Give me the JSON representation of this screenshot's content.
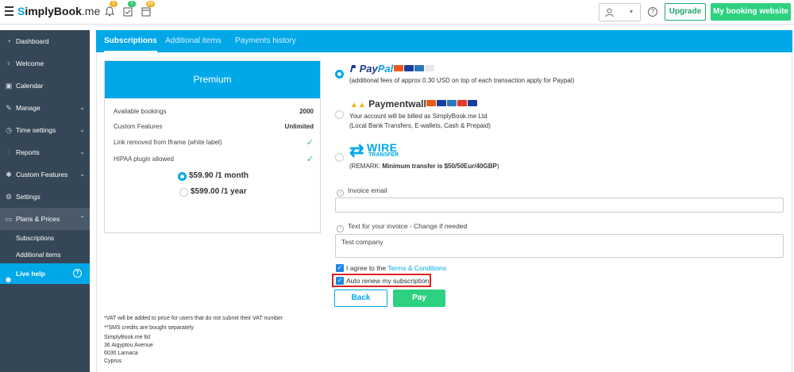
{
  "brand": {
    "logo_prefix": "S",
    "logo_main": "implyBook",
    "logo_suffix": ".me"
  },
  "topbar": {
    "notifications": [
      {
        "icon": "bell-icon",
        "badge": "0",
        "badge_color": "#f3b223"
      },
      {
        "icon": "tasks-icon",
        "badge": "0",
        "badge_color": "#2dc46c"
      },
      {
        "icon": "calendar-alert-icon",
        "badge": "99",
        "badge_color": "#f3b223"
      }
    ],
    "user_caret": "▾",
    "help": "?",
    "upgrade_label": "Upgrade",
    "booking_site_label": "My booking website"
  },
  "sidebar": {
    "items": [
      {
        "label": "Dashboard",
        "icon": "dashboard-icon",
        "has_chevron": false
      },
      {
        "label": "Welcome",
        "icon": "bulb-icon",
        "has_chevron": false
      },
      {
        "label": "Calendar",
        "icon": "calendar-icon",
        "has_chevron": false
      },
      {
        "label": "Manage",
        "icon": "pencil-icon",
        "has_chevron": true
      },
      {
        "label": "Time settings",
        "icon": "clock-icon",
        "has_chevron": true
      },
      {
        "label": "Reports",
        "icon": "chart-icon",
        "has_chevron": true
      },
      {
        "label": "Custom Features",
        "icon": "puzzle-icon",
        "has_chevron": true
      },
      {
        "label": "Settings",
        "icon": "gear-icon",
        "has_chevron": false
      },
      {
        "label": "Plans & Prices",
        "icon": "card-icon",
        "has_chevron": true
      }
    ],
    "subitems": [
      "Subscriptions",
      "Additional items"
    ],
    "live_help": "Live help"
  },
  "tabs": [
    {
      "label": "Subscriptions",
      "active": true
    },
    {
      "label": "Additional items",
      "active": false
    },
    {
      "label": "Payments history",
      "active": false
    }
  ],
  "plan": {
    "name": "Premium",
    "rows": [
      {
        "label": "Available bookings",
        "value": "2000"
      },
      {
        "label": "Custom Features",
        "value": "Unlimited"
      },
      {
        "label": "Link removed from Iframe (white label)",
        "value": "✓"
      },
      {
        "label": "HIPAA plugin allowed",
        "value": "✓"
      }
    ],
    "prices": [
      {
        "label": "$59.90 /1 month",
        "selected": true
      },
      {
        "label": "$599.00 /1 year",
        "selected": false
      }
    ]
  },
  "payments": {
    "paypal": {
      "logo_a": "Pay",
      "logo_b": "Pal",
      "desc": "(additional fees of approx 0.30 USD on top of each transaction apply for Paypal)",
      "selected": true
    },
    "paymentwall": {
      "logo": "Paymentwall",
      "line1": "Your account will be billed as SimplyBook.me Ltd",
      "line2": "(Local Bank Transfers, E-wallets, Cash & Prepaid)",
      "selected": false
    },
    "wire": {
      "logo_a": "WIRE",
      "logo_b": "TRANSFER",
      "remark_prefix": "(REMARK: ",
      "remark_bold": "Minimum transfer is $50/50Eur/40GBP",
      "remark_suffix": ")",
      "selected": false
    }
  },
  "form": {
    "invoice_email_label": "Invoice email",
    "invoice_email_value": "",
    "invoice_text_label": "Text for your invoice - Change if needed",
    "invoice_text_value": "Test company",
    "agree_prefix": "I agree to the ",
    "agree_link": "Terms & Conditions",
    "auto_renew": "Auto renew my subscription",
    "back": "Back",
    "pay": "Pay"
  },
  "footer": {
    "note1": "*VAT will be added to price for users that do not submit their VAT number",
    "note2": "**SMS credits are bought separately",
    "address": [
      "SimplyBook.me ltd",
      "36 Aigyptou Avenue",
      "6030 Larnaca",
      "Cyprus"
    ]
  },
  "colors": {
    "accent": "#00a8e8",
    "green": "#2dd17f",
    "sidebar": "#354756",
    "highlight": "#e02020"
  }
}
